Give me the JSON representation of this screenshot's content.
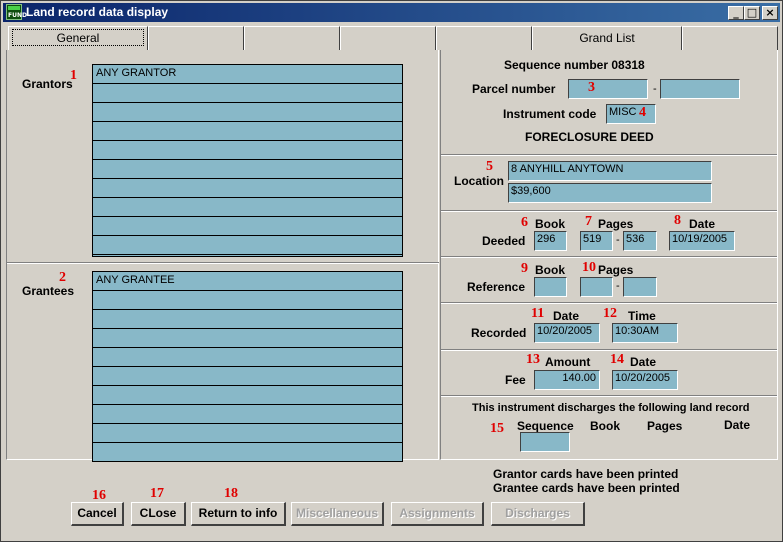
{
  "window": {
    "title": "Land record data display",
    "app_icon_text": "FUND",
    "minimize_glyph": "_",
    "maximize_glyph": "□",
    "close_glyph": "×"
  },
  "tabs": [
    "General",
    "",
    "",
    "",
    "",
    "Grand List",
    ""
  ],
  "grantors": {
    "label": "Grantors",
    "marker": "1",
    "rows": [
      "ANY GRANTOR",
      "",
      "",
      "",
      "",
      "",
      "",
      "",
      "",
      "",
      ""
    ]
  },
  "grantees": {
    "label": "Grantees",
    "marker": "2",
    "rows": [
      "ANY GRANTEE",
      "",
      "",
      "",
      "",
      "",
      "",
      "",
      "",
      ""
    ]
  },
  "record": {
    "sequence_text": "Sequence number 08318",
    "parcel_label": "Parcel number",
    "parcel_marker": "3",
    "parcel_value_1": "",
    "parcel_value_2": "",
    "instrument_label": "Instrument code",
    "instrument_value": "MISC",
    "instrument_marker": "4",
    "instrument_desc": "FORECLOSURE DEED"
  },
  "location": {
    "label": "Location",
    "marker": "5",
    "address": "8 ANYHILL ANYTOWN",
    "value": "$39,600"
  },
  "deeded": {
    "label": "Deeded",
    "book_header": "Book",
    "pages_header": "Pages",
    "date_header": "Date",
    "book_marker": "6",
    "pages_marker": "7",
    "date_marker": "8",
    "book": "296",
    "page_from": "519",
    "page_to": "536",
    "date": "10/19/2005"
  },
  "reference": {
    "label": "Reference",
    "book_header": "Book",
    "pages_header": "Pages",
    "book_marker": "9",
    "pages_marker": "10",
    "book": "",
    "page_from": "",
    "page_to": ""
  },
  "recorded": {
    "label": "Recorded",
    "date_header": "Date",
    "time_header": "Time",
    "date_marker": "11",
    "time_marker": "12",
    "date": "10/20/2005",
    "time": "10:30AM"
  },
  "fee": {
    "label": "Fee",
    "amount_header": "Amount",
    "date_header": "Date",
    "amount_marker": "13",
    "date_marker": "14",
    "amount": "140.00",
    "date": "10/20/2005"
  },
  "discharges": {
    "text": "This instrument discharges the following land record",
    "marker": "15",
    "seq_header": "Sequence",
    "book_header": "Book",
    "pages_header": "Pages",
    "date_header": "Date",
    "sequence": ""
  },
  "status": {
    "line1": "Grantor cards have been printed",
    "line2": "Grantee cards have been printed"
  },
  "buttons": {
    "cancel": "Cancel",
    "close": "CLose",
    "return": "Return to info",
    "misc": "Miscellaneous",
    "assignments": "Assignments",
    "discharges": "Discharges",
    "cancel_marker": "16",
    "close_marker": "17",
    "return_marker": "18"
  }
}
